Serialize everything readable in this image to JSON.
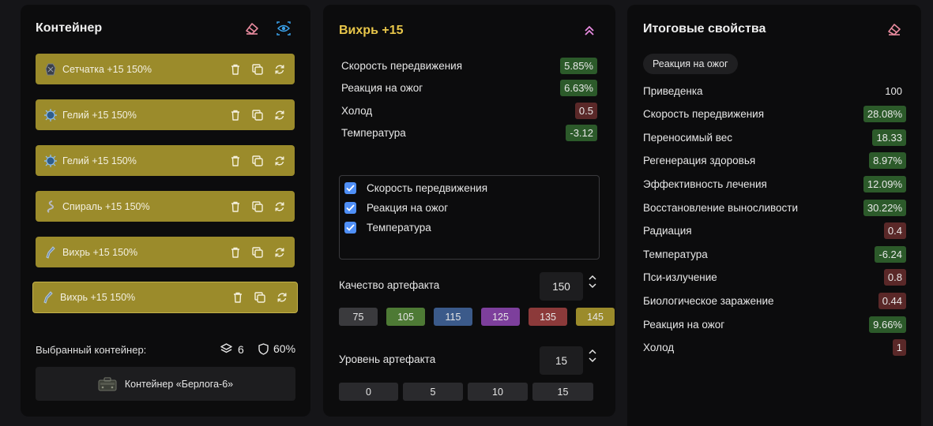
{
  "container_panel": {
    "title": "Контейнер",
    "items": [
      {
        "name": "Сетчатка +15 150%",
        "icon": "setchatka-artifact-icon"
      },
      {
        "name": "Гелий +15 150%",
        "icon": "geliy-artifact-icon"
      },
      {
        "name": "Гелий +15 150%",
        "icon": "geliy-artifact-icon"
      },
      {
        "name": "Спираль +15 150%",
        "icon": "spiral-artifact-icon"
      },
      {
        "name": "Вихрь +15 150%",
        "icon": "vikhr-artifact-icon"
      },
      {
        "name": "Вихрь +15 150%",
        "icon": "vikhr-artifact-icon"
      }
    ],
    "selected_label": "Выбранный контейнер:",
    "slots": "6",
    "protection": "60%",
    "container_name": "Контейнер «Берлога-6»"
  },
  "artifact_panel": {
    "title": "Вихрь +15",
    "properties": [
      {
        "label": "Скорость передвижения",
        "value": "5.85%",
        "tone": "positive"
      },
      {
        "label": "Реакция на ожог",
        "value": "6.63%",
        "tone": "positive"
      },
      {
        "label": "Холод",
        "value": "0.5",
        "tone": "negative"
      },
      {
        "label": "Температура",
        "value": "-3.12",
        "tone": "positive"
      }
    ],
    "checks": [
      {
        "label": "Скорость передвижения",
        "checked": true
      },
      {
        "label": "Реакция на ожог",
        "checked": true
      },
      {
        "label": "Температура",
        "checked": true
      }
    ],
    "quality": {
      "label": "Качество артефакта",
      "value": "150",
      "presets": [
        {
          "value": "75",
          "color": "#3a3a3d"
        },
        {
          "value": "105",
          "color": "#4e7a35"
        },
        {
          "value": "115",
          "color": "#3b5a8a"
        },
        {
          "value": "125",
          "color": "#7d3f9c"
        },
        {
          "value": "135",
          "color": "#8c3a3a"
        },
        {
          "value": "145",
          "color": "#9b8b2b"
        }
      ]
    },
    "level": {
      "label": "Уровень артефакта",
      "value": "15",
      "presets": [
        "0",
        "5",
        "10",
        "15"
      ]
    }
  },
  "totals_panel": {
    "title": "Итоговые свойства",
    "tag": "Реакция на ожог",
    "rows": [
      {
        "label": "Приведенка",
        "value": "100",
        "tone": "plain"
      },
      {
        "label": "Скорость передвижения",
        "value": "28.08%",
        "tone": "positive"
      },
      {
        "label": "Переносимый вес",
        "value": "18.33",
        "tone": "positive"
      },
      {
        "label": "Регенерация здоровья",
        "value": "8.97%",
        "tone": "positive"
      },
      {
        "label": "Эффективность лечения",
        "value": "12.09%",
        "tone": "positive"
      },
      {
        "label": "Восстановление выносливости",
        "value": "30.22%",
        "tone": "positive"
      },
      {
        "label": "Радиация",
        "value": "0.4",
        "tone": "negative"
      },
      {
        "label": "Температура",
        "value": "-6.24",
        "tone": "positive"
      },
      {
        "label": "Пси-излучение",
        "value": "0.8",
        "tone": "negative"
      },
      {
        "label": "Биологическое заражение",
        "value": "0.44",
        "tone": "negative"
      },
      {
        "label": "Реакция на ожог",
        "value": "9.66%",
        "tone": "positive"
      },
      {
        "label": "Холод",
        "value": "1",
        "tone": "negative"
      }
    ]
  },
  "colors": {
    "accent_yellow": "#e8c64a",
    "item_bg": "#9b8b2b",
    "positive": "#2c5a2a",
    "negative": "#5a2828",
    "eraser": "#e88b9e",
    "eye": "#3aa0e8"
  }
}
